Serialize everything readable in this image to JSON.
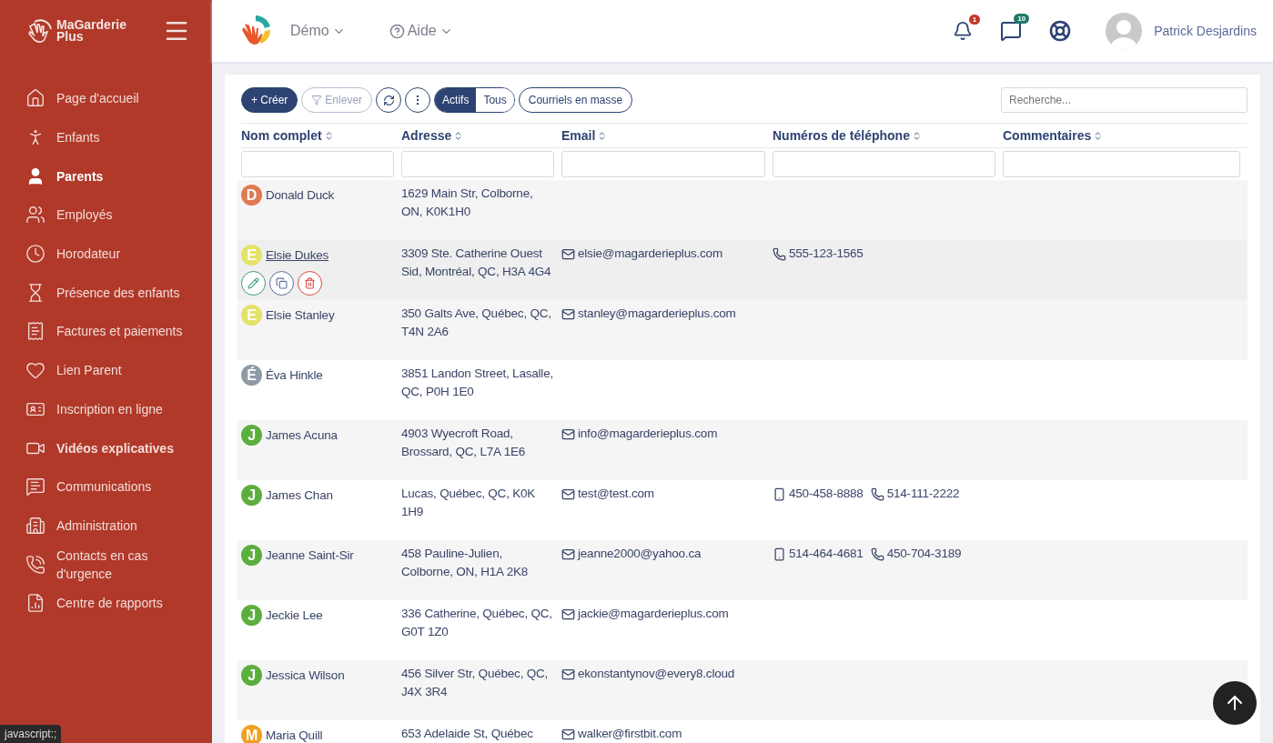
{
  "sidebar": {
    "brand": [
      "MaGarderie",
      "Plus"
    ],
    "items": [
      {
        "label": "Page d'accueil",
        "selected": false,
        "bold": false
      },
      {
        "label": "Enfants",
        "selected": false,
        "bold": false
      },
      {
        "label": "Parents",
        "selected": true,
        "bold": true
      },
      {
        "label": "Employés",
        "selected": false,
        "bold": false
      },
      {
        "label": "Horodateur",
        "selected": false,
        "bold": false
      },
      {
        "label": "Présence des enfants",
        "selected": false,
        "bold": false
      },
      {
        "label": "Factures et paiements",
        "selected": false,
        "bold": false
      },
      {
        "label": "Lien Parent",
        "selected": false,
        "bold": false
      },
      {
        "label": "Inscription en ligne",
        "selected": false,
        "bold": false
      },
      {
        "label": "Vidéos explicatives",
        "selected": false,
        "bold": true
      },
      {
        "label": "Communications",
        "selected": false,
        "bold": false
      },
      {
        "label": "Administration",
        "selected": false,
        "bold": false
      },
      {
        "label": "Contacts en cas d'urgence",
        "selected": false,
        "bold": false
      },
      {
        "label": "Centre de rapports",
        "selected": false,
        "bold": false
      }
    ]
  },
  "header": {
    "menus": [
      "Démo",
      "Aide"
    ],
    "notifications_badge": "1",
    "messages_badge": "10",
    "user": "Patrick Desjardins"
  },
  "toolbar": {
    "create": "+ Créer",
    "remove": "Enlever",
    "filters": [
      {
        "label": "Actifs",
        "selected": true
      },
      {
        "label": "Tous",
        "selected": false
      }
    ],
    "bulk_email": "Courriels en masse",
    "search": {
      "placeholder": "Recherche..."
    }
  },
  "table": {
    "columns": [
      "Nom complet",
      "Adresse",
      "Email",
      "Numéros de téléphone",
      "Commentaires"
    ],
    "rows": [
      {
        "initial": "D",
        "color": "#e07a52",
        "name": "Donald Duck",
        "address": "1629 Main Str, Colborne, ON, K0K1H0",
        "hovered": false,
        "phones": []
      },
      {
        "initial": "E",
        "color": "#e4e26a",
        "name": "Elsie Dukes",
        "address": "3309 Ste. Catherine Ouest Sid, Montréal, QC, H3A 4G4",
        "email": "elsie@magarderieplus.com",
        "hovered": true,
        "phones": [
          {
            "kind": "landline",
            "number": "555-123-1565"
          }
        ]
      },
      {
        "initial": "E",
        "color": "#e4e26a",
        "name": "Elsie Stanley",
        "address": "350 Galts Ave, Québec, QC, T4N 2A6",
        "email": "stanley@magarderieplus.com",
        "hovered": false,
        "phones": []
      },
      {
        "initial": "É",
        "color": "#8e9aa6",
        "name": "Éva Hinkle",
        "address": "3851 Landon Street, Lasalle, QC, P0H 1E0",
        "hovered": false,
        "phones": []
      },
      {
        "initial": "J",
        "color": "#5cae3e",
        "name": "James Acuna",
        "address": "4903 Wyecroft Road, Brossard, QC, L7A 1E6",
        "email": "info@magarderieplus.com",
        "hovered": false,
        "phones": []
      },
      {
        "initial": "J",
        "color": "#5cae3e",
        "name": "James Chan",
        "address": "Lucas, Québec, QC, K0K 1H9",
        "email": "test@test.com",
        "hovered": false,
        "phones": [
          {
            "kind": "mobile",
            "number": "450-458-8888"
          },
          {
            "kind": "landline",
            "number": "514-111-2222"
          }
        ]
      },
      {
        "initial": "J",
        "color": "#5cae3e",
        "name": "Jeanne Saint-Sir",
        "address": "458 Pauline-Julien, Colborne, ON, H1A 2K8",
        "email": "jeanne2000@yahoo.ca",
        "hovered": false,
        "phones": [
          {
            "kind": "mobile",
            "number": "514-464-4681"
          },
          {
            "kind": "landline",
            "number": "450-704-3189"
          }
        ]
      },
      {
        "initial": "J",
        "color": "#5cae3e",
        "name": "Jeckie Lee",
        "address": "336 Catherine, Québec, QC, G0T 1Z0",
        "email": "jackie@magarderieplus.com",
        "hovered": false,
        "phones": []
      },
      {
        "initial": "J",
        "color": "#5cae3e",
        "name": "Jessica Wilson",
        "address": "456 Silver Str, Québec, QC, J4X 3R4",
        "email": "ekonstantynov@every8.cloud",
        "hovered": false,
        "phones": []
      },
      {
        "initial": "M",
        "color": "#f0a020",
        "name": "Maria Quill",
        "address": "653 Adelaide St, Québec",
        "email": "walker@firstbit.com",
        "hovered": false,
        "phones": []
      }
    ]
  },
  "status_bar": "javascript:;"
}
